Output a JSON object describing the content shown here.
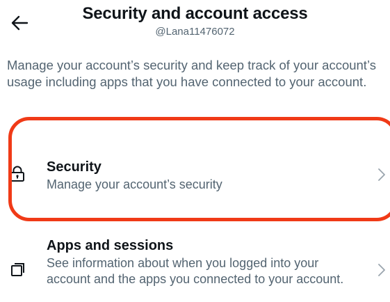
{
  "header": {
    "title": "Security and account access",
    "handle": "@Lana11476072",
    "back_icon": "arrow-left-icon"
  },
  "intro": "Manage your account’s security and keep track of your account’s usage including apps that you have connected to your account.",
  "items": [
    {
      "label": "Security",
      "description": "Manage your account’s security",
      "icon": "lock-icon"
    },
    {
      "label": "Apps and sessions",
      "description": "See information about when you logged into your account and the apps you connected to your account.",
      "icon": "apps-icon"
    }
  ],
  "colors": {
    "text": "#0f1419",
    "secondary": "#536471",
    "highlight": "#f03a17"
  }
}
